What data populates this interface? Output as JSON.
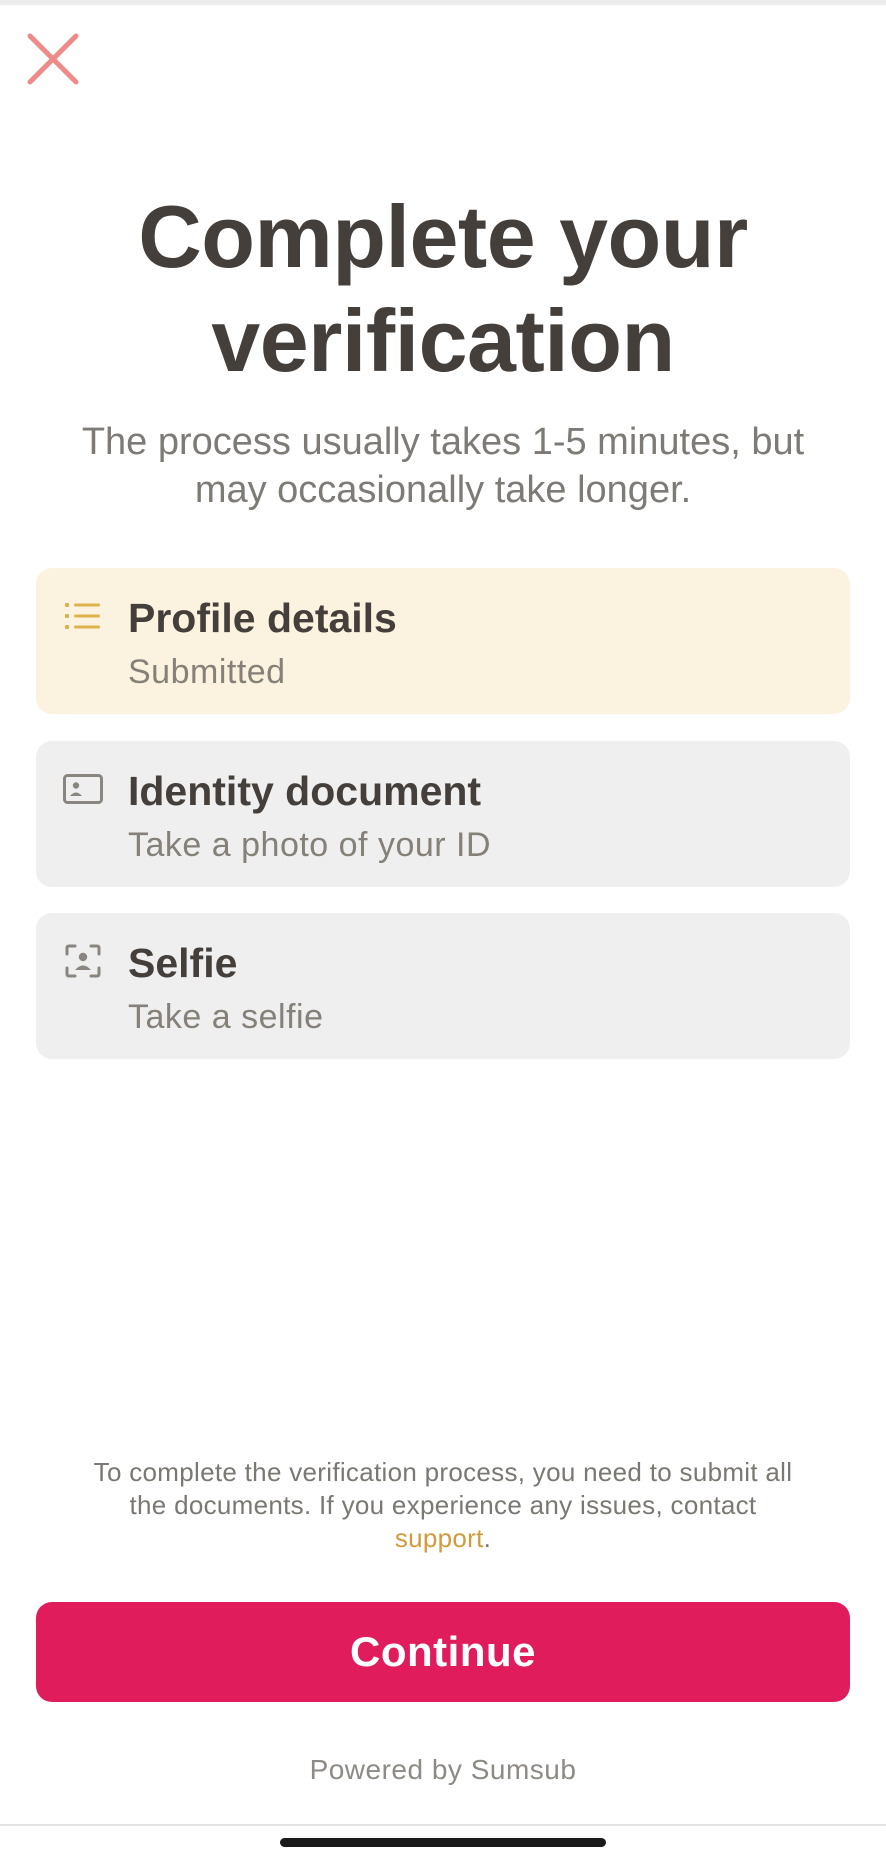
{
  "header": {
    "close_icon": "close-icon",
    "close_color": "#f08a8a"
  },
  "main": {
    "title_line1": "Complete your",
    "title_line2": "verification",
    "subtitle_line1": "The process usually takes 1-5 minutes, but",
    "subtitle_line2": "may occasionally take longer."
  },
  "steps": [
    {
      "title": "Profile details",
      "subtitle": "Submitted",
      "icon": "list-icon",
      "state": "active",
      "background": "#fbf3df",
      "icon_color": "#e0b24a"
    },
    {
      "title": "Identity document",
      "subtitle": "Take a photo of your ID",
      "icon": "id-card-icon",
      "state": "pending",
      "background": "#efefef",
      "icon_color": "#8a867f"
    },
    {
      "title": "Selfie",
      "subtitle": "Take a selfie",
      "icon": "face-scan-icon",
      "state": "pending",
      "background": "#efefef",
      "icon_color": "#8a867f"
    }
  ],
  "footer": {
    "note_line1": "To complete the verification process, you need to submit all",
    "note_line2": "the documents. If you experience any issues, contact",
    "support_link": "support",
    "note_end": ".",
    "link_color": "#d29a3a",
    "continue_label": "Continue",
    "continue_color": "#e01c5c",
    "powered_by": "Powered by Sumsub"
  }
}
